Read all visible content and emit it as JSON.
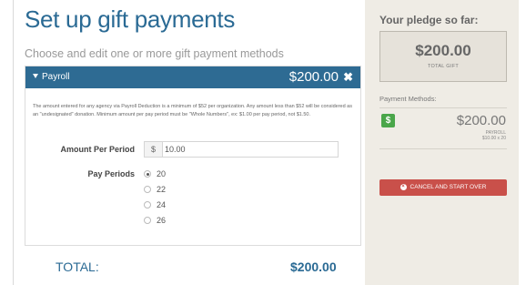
{
  "main": {
    "title": "Set up gift payments",
    "subtitle": "Choose and edit one or more gift payment methods",
    "panel": {
      "title": "Payroll",
      "amount": "$200.00",
      "close_glyph": "✖",
      "notice": "The amount entered for any agency via Payroll Deduction is a minimum of $52 per organization. Any amount less than $52 will be considered as an \"undesignated\" donation. Minimum amount per pay period must be \"Whole Numbers\", ex: $1.00 per pay period, not $1.50.",
      "amount_label": "Amount Per Period",
      "currency_prefix": "$",
      "amount_value": "10.00",
      "periods_label": "Pay Periods",
      "periods": [
        {
          "label": "20",
          "checked": true
        },
        {
          "label": "22",
          "checked": false
        },
        {
          "label": "24",
          "checked": false
        },
        {
          "label": "26",
          "checked": false
        }
      ]
    },
    "total_label": "TOTAL:",
    "total_value": "$200.00"
  },
  "side": {
    "title": "Your pledge so far:",
    "pledge_value": "$200.00",
    "pledge_label": "TOTAL GIFT",
    "methods_title": "Payment Methods:",
    "method_icon": "dollar-icon",
    "method_icon_glyph": "$",
    "method_amount": "$200.00",
    "method_type": "PAYROLL",
    "method_detail": "$10.00 x 20",
    "cancel_label": "CANCEL AND START OVER"
  },
  "colors": {
    "brand_blue": "#2e6b93",
    "sidebar_bg": "#efece5",
    "cancel_red": "#c9504a",
    "icon_green": "#4aa64a"
  }
}
